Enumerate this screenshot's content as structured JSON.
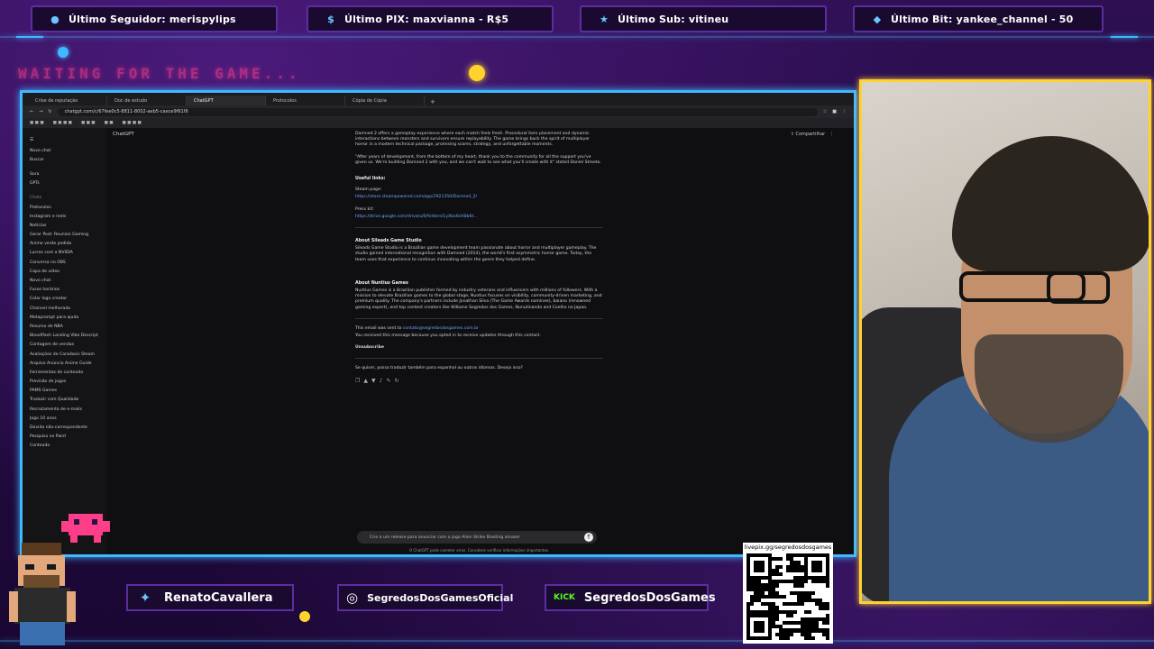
{
  "overlay": {
    "tickers": [
      {
        "label": "Último Seguidor: merispylips",
        "icon": "user-icon"
      },
      {
        "label": "Último PIX: maxvianna - R$5",
        "icon": "dollar-icon"
      },
      {
        "label": "Último Sub: vitineu",
        "icon": "star-icon"
      },
      {
        "label": "Último Bit: yankee_channel - 50",
        "icon": "diamond-icon"
      }
    ],
    "waiting_text": "WAITING FOR THE GAME...",
    "social": [
      {
        "label": "RenatoCavallera",
        "icon": "twitter-icon"
      },
      {
        "label": "SegredosDosGamesOficial",
        "icon": "instagram-icon"
      },
      {
        "label": "SegredosDosGames",
        "icon": "kick-icon",
        "badge": "KICK"
      }
    ],
    "qr_label": "livepix.gg/segredosdosgames",
    "colors": {
      "frame": "#3fb8ff",
      "cam_border": "#ffd22e",
      "accent": "#ff3e8a"
    }
  },
  "browser": {
    "address": "chatgpt.com/c/67fee0c5-8811-8002-aeb5-caece9f61f6",
    "sidebar": {
      "title": "ChatGPT",
      "top_items": [
        "Novo chat",
        "Buscar",
        "Sora",
        "GPTs"
      ],
      "section": "Chats",
      "items": [
        "Protocolos",
        "Instagram e reels",
        "Notícias",
        "Gerar Post: Reunion Gaming",
        "Anime verde pedido",
        "Lucros com a NVIDIA",
        "Conversa no OBS",
        "Capa de vídeo",
        "Novo chat",
        "Fusos horários",
        "Colar logo creator",
        "Channel melhorado",
        "Metaprompt para ajuda",
        "Resumo de NBA",
        "Bloodflash Landing Vibe Descript",
        "Contagem de vendas",
        "Avaliações de Caradoxis Steam",
        "Arquivo Anúncio Anime Guide",
        "Ferramentas de conteúdo",
        "Previsão de jogos",
        "PAMS Games",
        "Traduzir com Qualidade",
        "Recrutamento de e-mails",
        "Jogo 10 anos",
        "Dúvida não-correspondente",
        "Pesquisa no Paint",
        "Conteúdo"
      ],
      "compose_label": "ChatGPT",
      "share_label": "Compartilhar"
    },
    "message": {
      "paragraphs": [
        "Damned 2 offers a gameplay experience where each match feels fresh. Procedural item placement and dynamic interactions between monsters and survivors ensure replayability. The game brings back the spirit of multiplayer horror in a modern technical package, promising scares, strategy, and unforgettable moments.",
        "\"After years of development, from the bottom of my heart, thank you to the community for all the support you've given us. We're building Damned 2 with you, and we can't wait to see what you'll create with it\" stated Daniel Streeto."
      ],
      "useful_links_title": "Useful links:",
      "steam_label": "Steam page:",
      "steam_url": "https://store.steampowered.com/app/2921350/Damned_2/",
      "presskit_label": "Press kit:",
      "presskit_url": "https://drive.google.com/drive/u/0/folders/1yXbo6eX8b6t...",
      "about_studio_title": "About Sileads Game Studio",
      "about_studio_text": "Sileads Game Studio is a Brazilian game development team passionate about horror and multiplayer gameplay. The studio gained international recognition with Damned (2014), the world's first asymmetric horror game. Today, the team uses that experience to continue innovating within the genre they helped define.",
      "about_nuntius_title": "About Nuntius Games",
      "about_nuntius_text": "Nuntius Games is a Brazilian publisher formed by industry veterans and influencers with millions of followers. With a mission to elevate Brazilian games to the global stage, Nuntius focuses on visibility, community-driven marketing, and premium quality. The company's partners include Jonathan Silva (The Game Awards nominee), baiano (renowned gaming expert), and top content creators like Wilbone Segredos dos Games, Nunutinanda and Coelho no Japao.",
      "email_sent": "This email was sent to ",
      "email_addr": "contato@segredosdosgames.com.br",
      "subscribed": "You received this message because you opted in to receive updates through this contact.",
      "unsubscribe": "Unsubscribe",
      "assistant_reply": "Se quiser, posso traduzir também para espanhol ou outros idiomas. Deseja isso?"
    },
    "composer_placeholder": "Crie a um release para anunciar com o jogo Alien Strike Blasting amazer",
    "disclaimer": "O ChatGPT pode cometer erros. Considere verificar informações importantes."
  }
}
